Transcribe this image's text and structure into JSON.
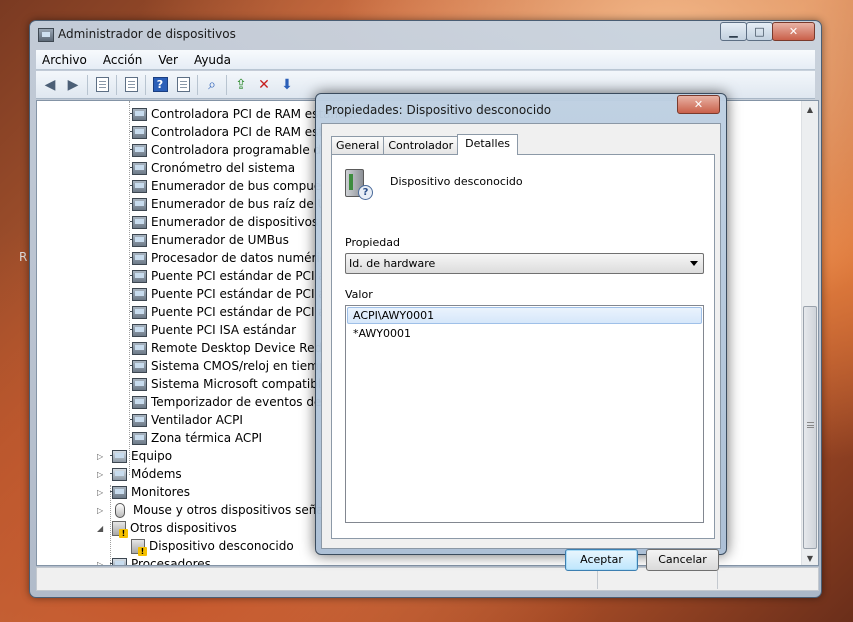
{
  "background": {
    "stray_text": "R"
  },
  "main_window": {
    "title": "Administrador de dispositivos",
    "controls": {
      "minimize": "▁",
      "maximize": "□",
      "close": "✕"
    },
    "menu": [
      "Archivo",
      "Acción",
      "Ver",
      "Ayuda"
    ],
    "toolbar": {
      "back": "back-arrow-icon",
      "forward": "forward-arrow-icon",
      "show_hide_tree": "console-tree-icon",
      "properties": "properties-icon",
      "help": "help-icon",
      "help_glyph": "?",
      "show": "show-icon",
      "scan": "scan-hardware-icon",
      "update_driver": "update-driver-icon",
      "uninstall": "uninstall-icon",
      "disable": "disable-icon"
    },
    "tree_children": [
      "Controladora PCI de RAM estándar",
      "Controladora PCI de RAM estándar",
      "Controladora programable de interrupciones",
      "Cronómetro del sistema",
      "Enumerador de bus compuesto",
      "Enumerador de bus raíz de UMBus",
      "Enumerador de dispositivos de software",
      "Enumerador de UMBus",
      "Procesador de datos numéricos",
      "Puente PCI estándar de PCI a PCI",
      "Puente PCI estándar de PCI a PCI",
      "Puente PCI estándar de PCI a PCI",
      "Puente PCI ISA estándar",
      "Remote Desktop Device Redirector Bus",
      "Sistema CMOS/reloj en tiempo real",
      "Sistema Microsoft compatible con ACPI",
      "Temporizador de eventos de alta precisión",
      "Ventilador ACPI",
      "Zona térmica ACPI"
    ],
    "tree_categories": [
      {
        "label": "Equipo",
        "expander": "▷"
      },
      {
        "label": "Módems",
        "expander": "▷"
      },
      {
        "label": "Monitores",
        "expander": "▷"
      },
      {
        "label": "Mouse y otros dispositivos señaladores",
        "expander": "▷"
      },
      {
        "label": "Otros dispositivos",
        "expander": "◢"
      }
    ],
    "unknown_device": "Dispositivo desconocido",
    "partial_category": {
      "label": "Procesadores",
      "expander": "▷"
    },
    "scrollbar": {
      "up": "▲",
      "down": "▼"
    }
  },
  "dialog": {
    "title": "Propiedades: Dispositivo desconocido",
    "close": "✕",
    "tabs": [
      "General",
      "Controlador",
      "Detalles"
    ],
    "active_tab": "Detalles",
    "device_name": "Dispositivo desconocido",
    "device_glyph": "?",
    "property_label": "Propiedad",
    "property_value": "Id. de hardware",
    "value_label": "Valor",
    "values": [
      "ACPI\\AWY0001",
      "*AWY0001"
    ],
    "ok_button": "Aceptar",
    "cancel_button": "Cancelar"
  }
}
